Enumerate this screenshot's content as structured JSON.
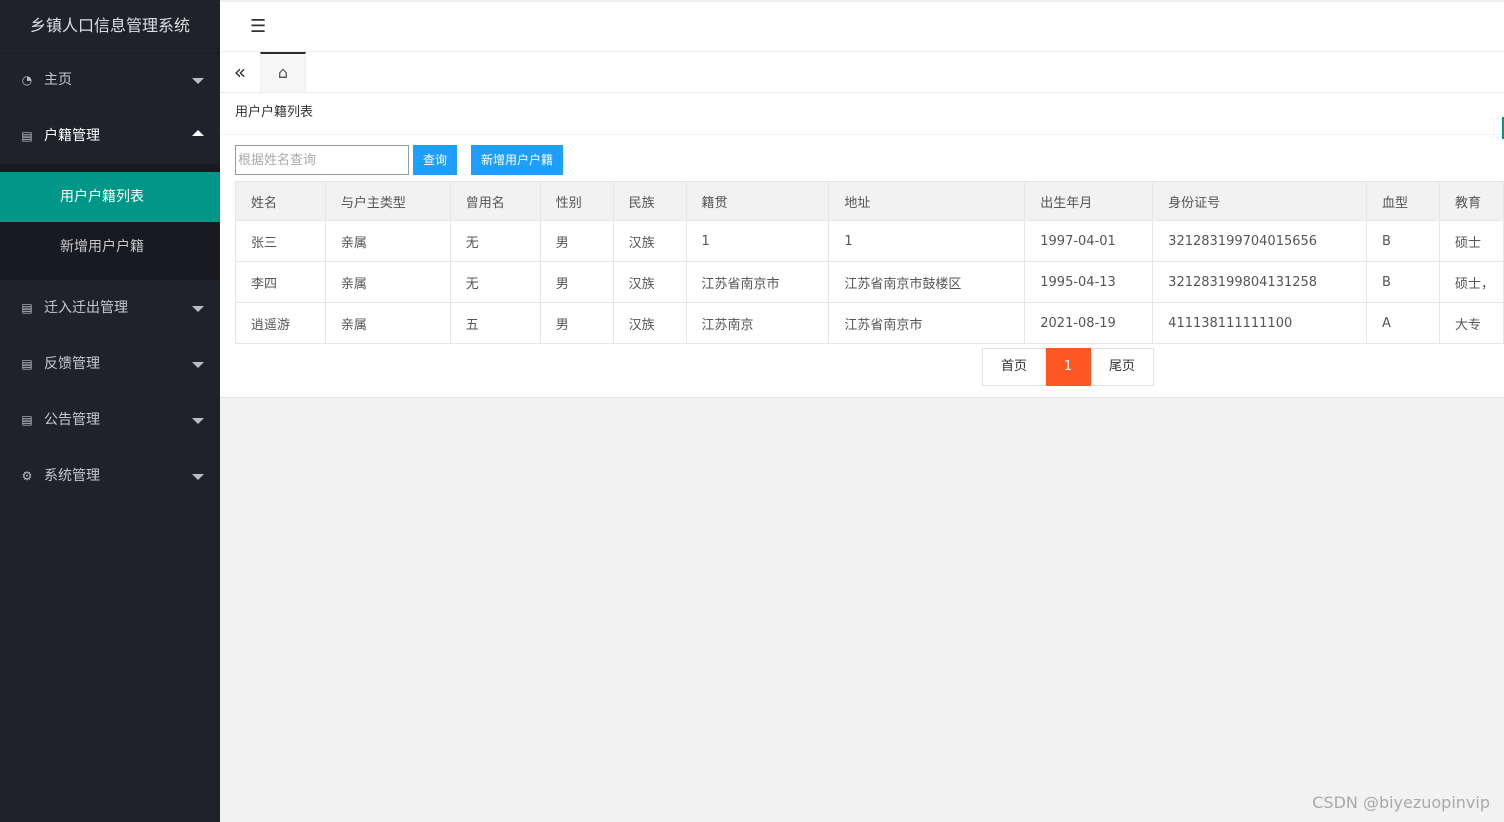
{
  "sidebar": {
    "logo": "乡镇人口信息管理系统",
    "items": [
      {
        "label": "主页",
        "icon": "dashboard-icon",
        "open": false
      },
      {
        "label": "户籍管理",
        "icon": "document-icon",
        "open": true,
        "children": [
          {
            "label": "用户户籍列表",
            "active": true
          },
          {
            "label": "新增用户户籍",
            "active": false
          }
        ]
      },
      {
        "label": "迁入迁出管理",
        "icon": "document-icon",
        "open": false
      },
      {
        "label": "反馈管理",
        "icon": "document-icon",
        "open": false
      },
      {
        "label": "公告管理",
        "icon": "document-icon",
        "open": false
      },
      {
        "label": "系统管理",
        "icon": "gear-icon",
        "open": false
      }
    ]
  },
  "header": {
    "flex_icon": "menu-shrink-icon"
  },
  "tabs": {
    "prev_icon": "double-chevron-left-icon",
    "home_icon": "home-icon"
  },
  "main": {
    "title": "用户户籍列表",
    "search": {
      "placeholder": "根据姓名查询",
      "value": ""
    },
    "query_label": "查询",
    "add_label": "新增用户户籍",
    "table": {
      "columns": [
        "姓名",
        "与户主类型",
        "曾用名",
        "性别",
        "民族",
        "籍贯",
        "地址",
        "出生年月",
        "身份证号",
        "血型",
        "教育"
      ],
      "rows": [
        [
          "张三",
          "亲属",
          "无",
          "男",
          "汉族",
          "1",
          "1",
          "1997-04-01",
          "321283199704015656",
          "B",
          "硕士"
        ],
        [
          "李四",
          "亲属",
          "无",
          "男",
          "汉族",
          "江苏省南京市",
          "江苏省南京市鼓楼区",
          "1995-04-13",
          "321283199804131258",
          "B",
          "硕士，"
        ],
        [
          "逍遥游",
          "亲属",
          "五",
          "男",
          "汉族",
          "江苏南京",
          "江苏省南京市",
          "2021-08-19",
          "411138111111100",
          "A",
          "大专"
        ]
      ]
    },
    "pager": {
      "first": "首页",
      "current": "1",
      "last": "尾页"
    }
  },
  "watermark": "CSDN @biyezuopinvip",
  "colors": {
    "sidebar": "#20222a",
    "active": "#009688",
    "button": "#1e9fff",
    "current_page": "#ff5722"
  }
}
